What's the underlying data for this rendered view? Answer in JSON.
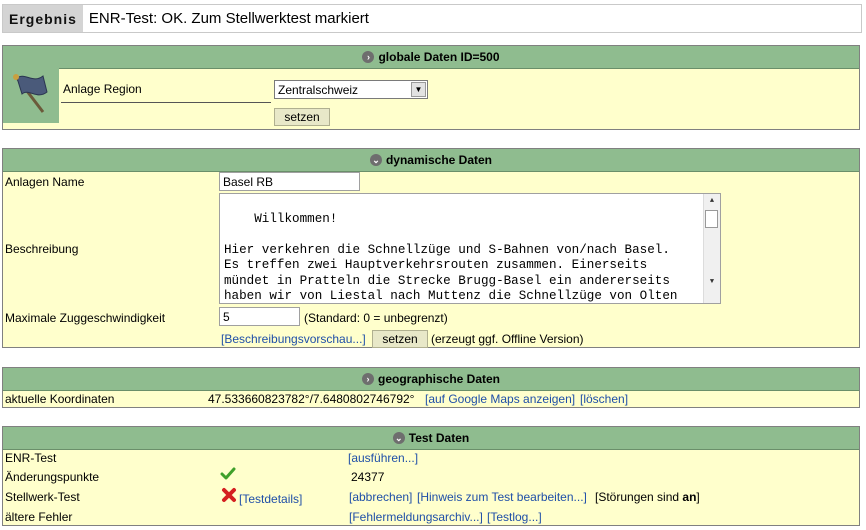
{
  "result": {
    "label": "Ergebnis",
    "text": "ENR-Test: OK. Zum Stellwerktest markiert"
  },
  "global": {
    "title": "globale Daten ID=500",
    "region_label": "Anlage Region",
    "region_value": "Zentralschweiz",
    "set_label": "setzen"
  },
  "dynamic": {
    "title": "dynamische Daten",
    "name_label": "Anlagen Name",
    "name_value": "Basel RB",
    "desc_label": "Beschreibung",
    "desc_value": "Willkommen!\n\nHier verkehren die Schnellzüge und S-Bahnen von/nach Basel.\nEs treffen zwei Hauptverkehrsrouten zusammen. Einerseits\nmündet in Pratteln die Strecke Brugg-Basel ein andererseits\nhaben wir von Liestal nach Muttenz die Schnellzüge von Olten\nund Zürich her.",
    "speed_label": "Maximale Zuggeschwindigkeit",
    "speed_value": "5",
    "speed_hint": "(Standard: 0 = unbegrenzt)",
    "preview_link": "[Beschreibungsvorschau...]",
    "set_label": "setzen",
    "offline_hint": "(erzeugt ggf. Offline Version)"
  },
  "geo": {
    "title": "geographische Daten",
    "coord_label": "aktuelle Koordinaten",
    "coord_value": "47.533660823782°/7.6480802746792°",
    "maps_link": "[auf Google Maps anzeigen]",
    "delete_link": "[löschen]"
  },
  "test": {
    "title": "Test Daten",
    "enr_label": "ENR-Test",
    "enr_run_link": "[ausführen...]",
    "change_label": "Änderungspunkte",
    "change_value": "24377",
    "stellwerk_label": "Stellwerk-Test",
    "details_link": "[Testdetails]",
    "abort_link": "[abbrechen]",
    "hint_link": "[Hinweis zum Test bearbeiten...]",
    "stoerungen_prefix": "[Störungen sind ",
    "stoerungen_value": "an",
    "stoerungen_suffix": "]",
    "old_errors_label": "ältere Fehler",
    "archive_link": "[Fehlermeldungsarchiv...]",
    "testlog_link": "[Testlog...]"
  },
  "colors": {
    "panel_bg": "#ffffcc",
    "header_bg": "#8fbc8f",
    "link": "#1f4fa8"
  }
}
